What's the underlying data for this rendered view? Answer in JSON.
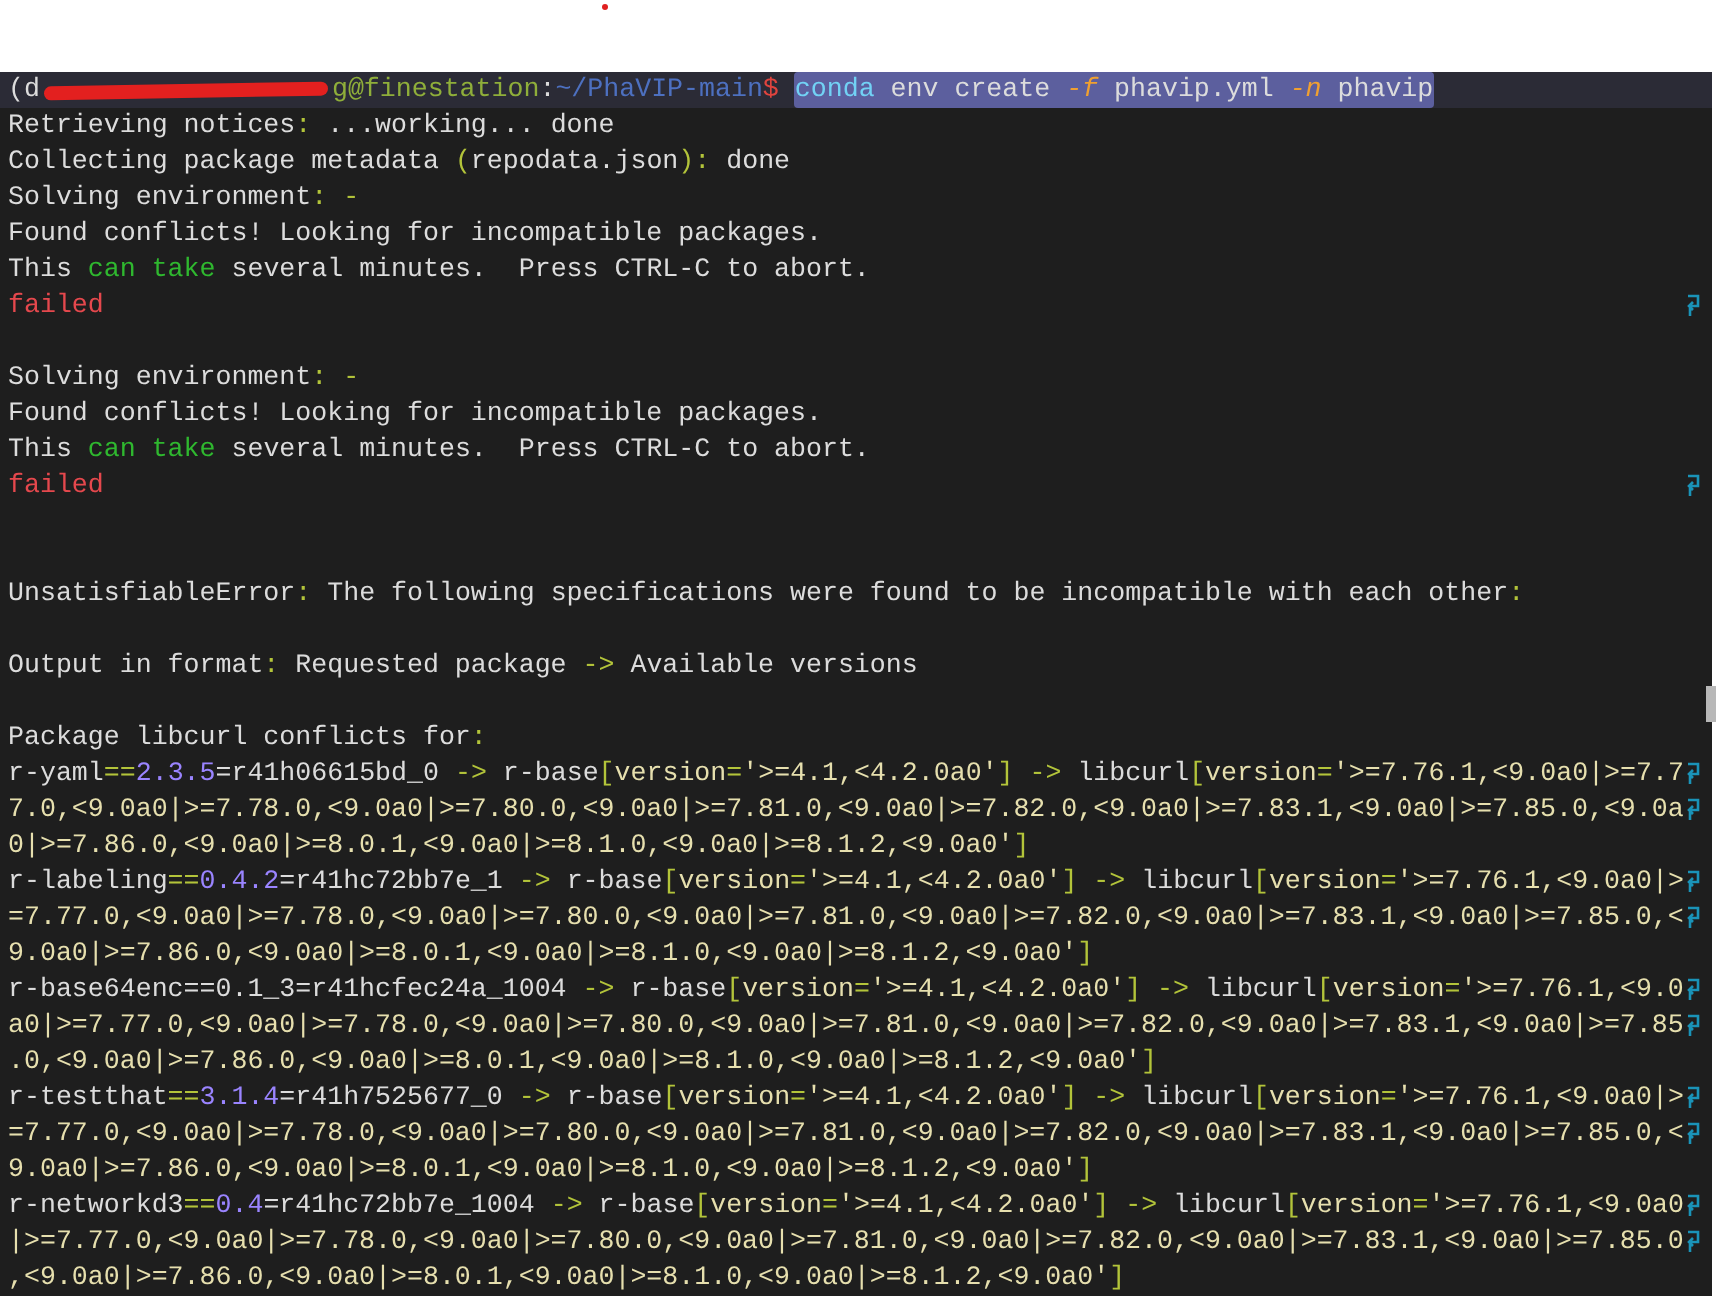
{
  "prompt": {
    "env_prefix": "(d",
    "redacted": true,
    "host": "g@finestation",
    "separator": ":",
    "path": "~/PhaVIP-main",
    "symbol": "$",
    "command_selected": true,
    "command": [
      {
        "text": "conda",
        "kind": "cmd"
      },
      {
        "text": " env create ",
        "kind": "text"
      },
      {
        "text": "-f",
        "kind": "flag"
      },
      {
        "text": " phavip.yml ",
        "kind": "text"
      },
      {
        "text": "-n",
        "kind": "flag"
      },
      {
        "text": " phavip",
        "kind": "text"
      }
    ]
  },
  "lines": [
    {
      "kind": "text",
      "segments": [
        {
          "text": "Retrieving notices",
          "kind": "text"
        },
        {
          "text": ":",
          "kind": "op"
        },
        {
          "text": " ...working... done",
          "kind": "text"
        }
      ]
    },
    {
      "kind": "text",
      "segments": [
        {
          "text": "Collecting package metadata ",
          "kind": "text"
        },
        {
          "text": "(",
          "kind": "op"
        },
        {
          "text": "repodata.json",
          "kind": "text"
        },
        {
          "text": ")",
          "kind": "op"
        },
        {
          "text": ":",
          "kind": "op"
        },
        {
          "text": " done",
          "kind": "text"
        }
      ]
    },
    {
      "kind": "text",
      "segments": [
        {
          "text": "Solving environment",
          "kind": "text"
        },
        {
          "text": ": -",
          "kind": "op"
        }
      ]
    },
    {
      "kind": "text",
      "segments": [
        {
          "text": "Found conflicts! Looking for incompatible packages.",
          "kind": "text"
        }
      ]
    },
    {
      "kind": "text",
      "segments": [
        {
          "text": "This ",
          "kind": "text"
        },
        {
          "text": "can take",
          "kind": "green"
        },
        {
          "text": " several minutes.  Press CTRL-C to abort.",
          "kind": "text"
        }
      ]
    },
    {
      "kind": "text",
      "wrapped": true,
      "segments": [
        {
          "text": "failed",
          "kind": "red"
        }
      ]
    },
    {
      "kind": "blank"
    },
    {
      "kind": "text",
      "segments": [
        {
          "text": "Solving environment",
          "kind": "text"
        },
        {
          "text": ": -",
          "kind": "op"
        }
      ]
    },
    {
      "kind": "text",
      "segments": [
        {
          "text": "Found conflicts! Looking for incompatible packages.",
          "kind": "text"
        }
      ]
    },
    {
      "kind": "text",
      "segments": [
        {
          "text": "This ",
          "kind": "text"
        },
        {
          "text": "can take",
          "kind": "green"
        },
        {
          "text": " several minutes.  Press CTRL-C to abort.",
          "kind": "text"
        }
      ]
    },
    {
      "kind": "text",
      "wrapped": true,
      "segments": [
        {
          "text": "failed",
          "kind": "red"
        }
      ]
    },
    {
      "kind": "blank"
    },
    {
      "kind": "blank"
    },
    {
      "kind": "text",
      "segments": [
        {
          "text": "UnsatisfiableError",
          "kind": "text"
        },
        {
          "text": ":",
          "kind": "op"
        },
        {
          "text": " The following specifications were found to be incompatible with each other",
          "kind": "text"
        },
        {
          "text": ":",
          "kind": "op"
        }
      ]
    },
    {
      "kind": "blank"
    },
    {
      "kind": "text",
      "segments": [
        {
          "text": "Output in format",
          "kind": "text"
        },
        {
          "text": ":",
          "kind": "op"
        },
        {
          "text": " Requested package ",
          "kind": "text"
        },
        {
          "text": "->",
          "kind": "op"
        },
        {
          "text": " Available versions",
          "kind": "text"
        }
      ]
    },
    {
      "kind": "blank"
    },
    {
      "kind": "text",
      "segments": [
        {
          "text": "Package libcurl conflicts for",
          "kind": "text"
        },
        {
          "text": ":",
          "kind": "op"
        }
      ]
    },
    {
      "kind": "text",
      "wrapped": true,
      "segments": [
        {
          "text": "r-yaml",
          "kind": "text"
        },
        {
          "text": "==",
          "kind": "op"
        },
        {
          "text": "2.3.5",
          "kind": "num"
        },
        {
          "text": "=r41h06615bd_0 ",
          "kind": "text"
        },
        {
          "text": "->",
          "kind": "op"
        },
        {
          "text": " r-base",
          "kind": "text"
        },
        {
          "text": "[",
          "kind": "op"
        },
        {
          "text": "version",
          "kind": "str"
        },
        {
          "text": "=",
          "kind": "op"
        },
        {
          "text": "'>=4.1,<4.2.0a0'",
          "kind": "str"
        },
        {
          "text": "] ->",
          "kind": "op"
        },
        {
          "text": " libcurl",
          "kind": "text"
        },
        {
          "text": "[",
          "kind": "op"
        },
        {
          "text": "version",
          "kind": "str"
        },
        {
          "text": "=",
          "kind": "op"
        },
        {
          "text": "'>=7.76.1,<9.0a0|>=7.7",
          "kind": "str"
        }
      ]
    },
    {
      "kind": "text",
      "wrapped": true,
      "segments": [
        {
          "text": "7.0,<9.0a0|>=7.78.0,<9.0a0|>=7.80.0,<9.0a0|>=7.81.0,<9.0a0|>=7.82.0,<9.0a0|>=7.83.1,<9.0a0|>=7.85.0,<9.0a",
          "kind": "str"
        }
      ]
    },
    {
      "kind": "text",
      "segments": [
        {
          "text": "0|>=7.86.0,<9.0a0|>=8.0.1,<9.0a0|>=8.1.0,<9.0a0|>=8.1.2,<9.0a0'",
          "kind": "str"
        },
        {
          "text": "]",
          "kind": "op"
        }
      ]
    },
    {
      "kind": "text",
      "wrapped": true,
      "segments": [
        {
          "text": "r-labeling",
          "kind": "text"
        },
        {
          "text": "==",
          "kind": "op"
        },
        {
          "text": "0.4.2",
          "kind": "num"
        },
        {
          "text": "=r41hc72bb7e_1 ",
          "kind": "text"
        },
        {
          "text": "->",
          "kind": "op"
        },
        {
          "text": " r-base",
          "kind": "text"
        },
        {
          "text": "[",
          "kind": "op"
        },
        {
          "text": "version",
          "kind": "str"
        },
        {
          "text": "=",
          "kind": "op"
        },
        {
          "text": "'>=4.1,<4.2.0a0'",
          "kind": "str"
        },
        {
          "text": "] ->",
          "kind": "op"
        },
        {
          "text": " libcurl",
          "kind": "text"
        },
        {
          "text": "[",
          "kind": "op"
        },
        {
          "text": "version",
          "kind": "str"
        },
        {
          "text": "=",
          "kind": "op"
        },
        {
          "text": "'>=7.76.1,<9.0a0|>",
          "kind": "str"
        }
      ]
    },
    {
      "kind": "text",
      "wrapped": true,
      "segments": [
        {
          "text": "=7.77.0,<9.0a0|>=7.78.0,<9.0a0|>=7.80.0,<9.0a0|>=7.81.0,<9.0a0|>=7.82.0,<9.0a0|>=7.83.1,<9.0a0|>=7.85.0,<",
          "kind": "str"
        }
      ]
    },
    {
      "kind": "text",
      "segments": [
        {
          "text": "9.0a0|>=7.86.0,<9.0a0|>=8.0.1,<9.0a0|>=8.1.0,<9.0a0|>=8.1.2,<9.0a0'",
          "kind": "str"
        },
        {
          "text": "]",
          "kind": "op"
        }
      ]
    },
    {
      "kind": "text",
      "wrapped": true,
      "segments": [
        {
          "text": "r-base64enc==0.1_3=r41hcfec24a_1004 ",
          "kind": "text"
        },
        {
          "text": "->",
          "kind": "op"
        },
        {
          "text": " r-base",
          "kind": "text"
        },
        {
          "text": "[",
          "kind": "op"
        },
        {
          "text": "version",
          "kind": "str"
        },
        {
          "text": "=",
          "kind": "op"
        },
        {
          "text": "'>=4.1,<4.2.0a0'",
          "kind": "str"
        },
        {
          "text": "] ->",
          "kind": "op"
        },
        {
          "text": " libcurl",
          "kind": "text"
        },
        {
          "text": "[",
          "kind": "op"
        },
        {
          "text": "version",
          "kind": "str"
        },
        {
          "text": "=",
          "kind": "op"
        },
        {
          "text": "'>=7.76.1,<9.0",
          "kind": "str"
        }
      ]
    },
    {
      "kind": "text",
      "wrapped": true,
      "segments": [
        {
          "text": "a0|>=7.77.0,<9.0a0|>=7.78.0,<9.0a0|>=7.80.0,<9.0a0|>=7.81.0,<9.0a0|>=7.82.0,<9.0a0|>=7.83.1,<9.0a0|>=7.85",
          "kind": "str"
        }
      ]
    },
    {
      "kind": "text",
      "segments": [
        {
          "text": ".0,<9.0a0|>=7.86.0,<9.0a0|>=8.0.1,<9.0a0|>=8.1.0,<9.0a0|>=8.1.2,<9.0a0'",
          "kind": "str"
        },
        {
          "text": "]",
          "kind": "op"
        }
      ]
    },
    {
      "kind": "text",
      "wrapped": true,
      "segments": [
        {
          "text": "r-testthat",
          "kind": "text"
        },
        {
          "text": "==",
          "kind": "op"
        },
        {
          "text": "3.1.4",
          "kind": "num"
        },
        {
          "text": "=r41h7525677_0 ",
          "kind": "text"
        },
        {
          "text": "->",
          "kind": "op"
        },
        {
          "text": " r-base",
          "kind": "text"
        },
        {
          "text": "[",
          "kind": "op"
        },
        {
          "text": "version",
          "kind": "str"
        },
        {
          "text": "=",
          "kind": "op"
        },
        {
          "text": "'>=4.1,<4.2.0a0'",
          "kind": "str"
        },
        {
          "text": "] ->",
          "kind": "op"
        },
        {
          "text": " libcurl",
          "kind": "text"
        },
        {
          "text": "[",
          "kind": "op"
        },
        {
          "text": "version",
          "kind": "str"
        },
        {
          "text": "=",
          "kind": "op"
        },
        {
          "text": "'>=7.76.1,<9.0a0|>",
          "kind": "str"
        }
      ]
    },
    {
      "kind": "text",
      "wrapped": true,
      "segments": [
        {
          "text": "=7.77.0,<9.0a0|>=7.78.0,<9.0a0|>=7.80.0,<9.0a0|>=7.81.0,<9.0a0|>=7.82.0,<9.0a0|>=7.83.1,<9.0a0|>=7.85.0,<",
          "kind": "str"
        }
      ]
    },
    {
      "kind": "text",
      "segments": [
        {
          "text": "9.0a0|>=7.86.0,<9.0a0|>=8.0.1,<9.0a0|>=8.1.0,<9.0a0|>=8.1.2,<9.0a0'",
          "kind": "str"
        },
        {
          "text": "]",
          "kind": "op"
        }
      ]
    },
    {
      "kind": "text",
      "wrapped": true,
      "segments": [
        {
          "text": "r-networkd3",
          "kind": "text"
        },
        {
          "text": "==",
          "kind": "op"
        },
        {
          "text": "0.4",
          "kind": "num"
        },
        {
          "text": "=r41hc72bb7e_1004 ",
          "kind": "text"
        },
        {
          "text": "->",
          "kind": "op"
        },
        {
          "text": " r-base",
          "kind": "text"
        },
        {
          "text": "[",
          "kind": "op"
        },
        {
          "text": "version",
          "kind": "str"
        },
        {
          "text": "=",
          "kind": "op"
        },
        {
          "text": "'>=4.1,<4.2.0a0'",
          "kind": "str"
        },
        {
          "text": "] ->",
          "kind": "op"
        },
        {
          "text": " libcurl",
          "kind": "text"
        },
        {
          "text": "[",
          "kind": "op"
        },
        {
          "text": "version",
          "kind": "str"
        },
        {
          "text": "=",
          "kind": "op"
        },
        {
          "text": "'>=7.76.1,<9.0a0",
          "kind": "str"
        }
      ]
    },
    {
      "kind": "text",
      "wrapped": true,
      "segments": [
        {
          "text": "|>=7.77.0,<9.0a0|>=7.78.0,<9.0a0|>=7.80.0,<9.0a0|>=7.81.0,<9.0a0|>=7.82.0,<9.0a0|>=7.83.1,<9.0a0|>=7.85.0",
          "kind": "str"
        }
      ]
    },
    {
      "kind": "text",
      "segments": [
        {
          "text": ",<9.0a0|>=7.86.0,<9.0a0|>=8.0.1,<9.0a0|>=8.1.0,<9.0a0|>=8.1.2,<9.0a0'",
          "kind": "str"
        },
        {
          "text": "]",
          "kind": "op"
        }
      ]
    }
  ]
}
